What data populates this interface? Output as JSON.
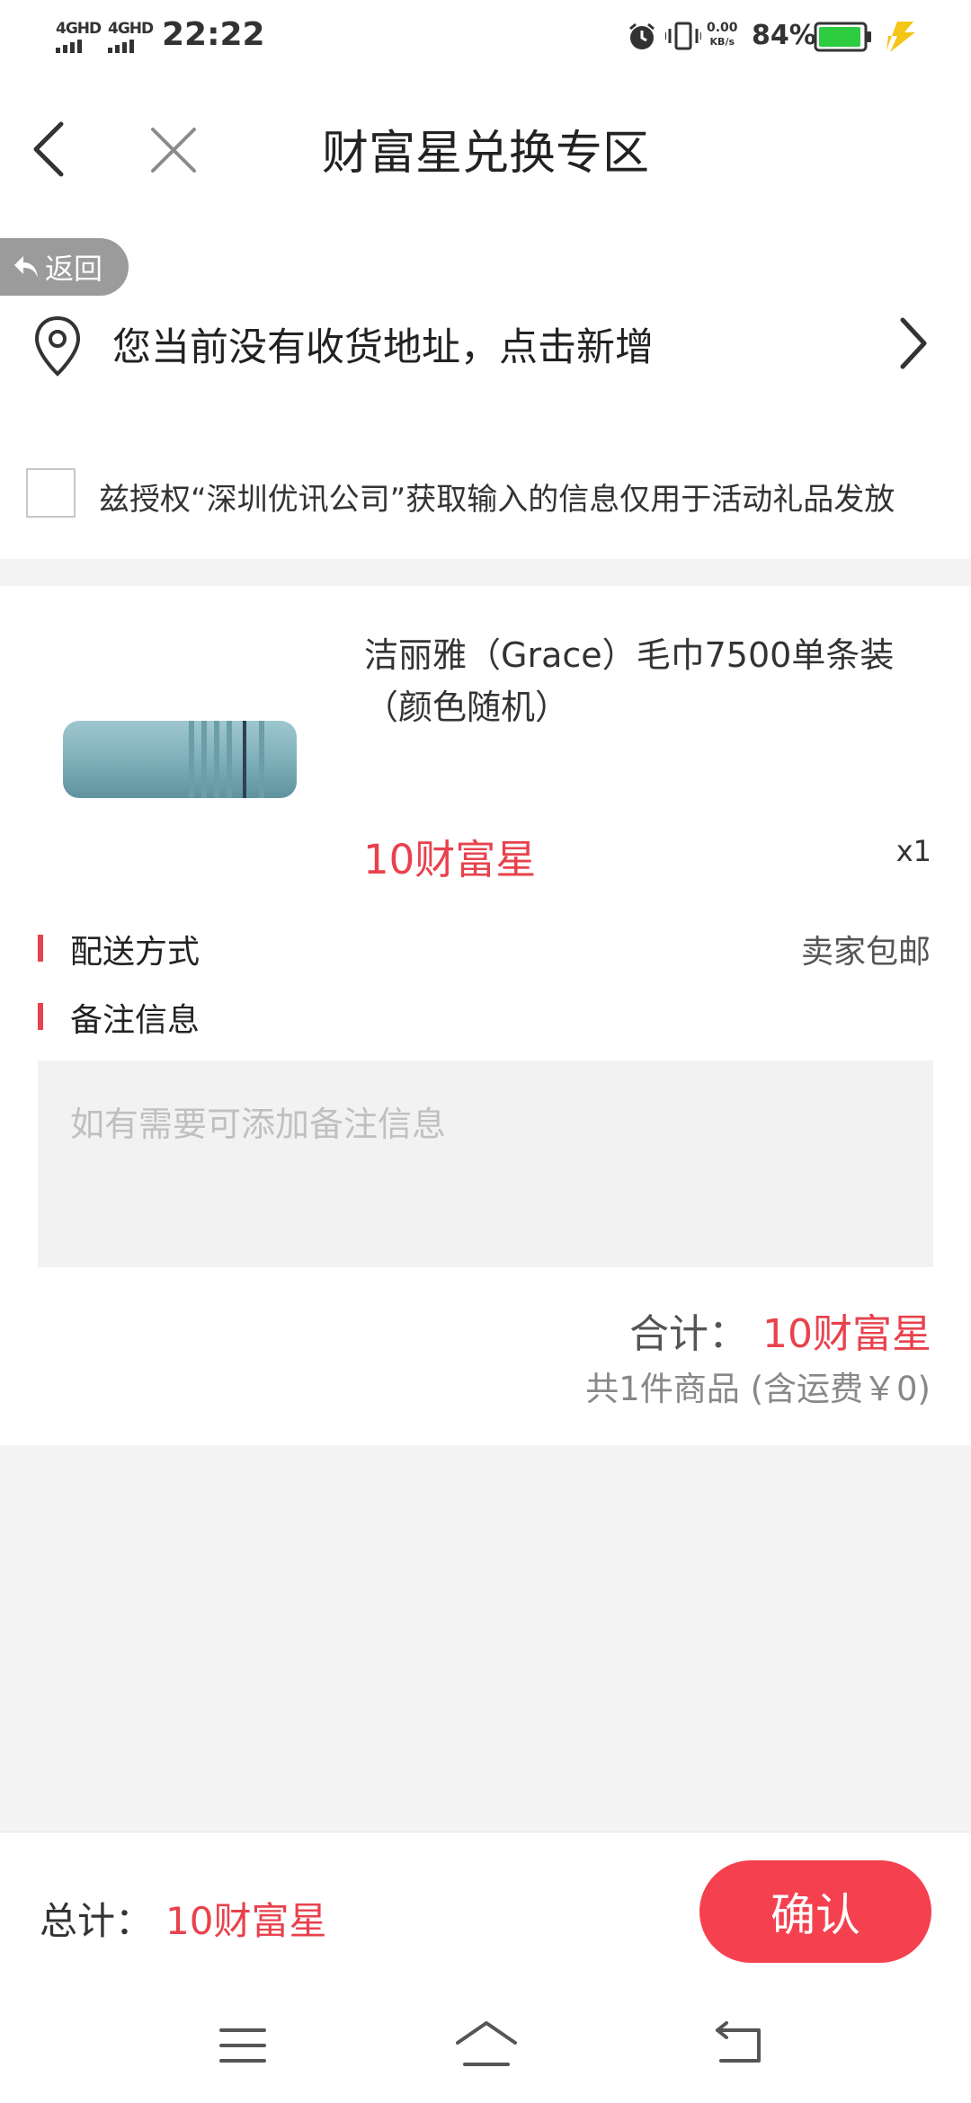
{
  "status_bar": {
    "signal1": "4GHD",
    "signal2": "4GHD",
    "time": "22:22",
    "speed_value": "0.00",
    "speed_unit": "KB/s",
    "battery": "84%"
  },
  "header": {
    "title": "财富星兑换专区"
  },
  "floating": {
    "back_label": "返回"
  },
  "address": {
    "text": "您当前没有收货地址，点击新增"
  },
  "authorization": {
    "text": "兹授权“深圳优讯公司”获取输入的信息仅用于活动礼品发放",
    "checked": false
  },
  "product": {
    "name": "洁丽雅（Grace）毛巾7500单条装（颜色随机）",
    "price": "10财富星",
    "quantity": "x1",
    "image_icon": "towel-image"
  },
  "delivery": {
    "label": "配送方式",
    "value": "卖家包邮"
  },
  "remarks": {
    "label": "备注信息",
    "placeholder": "如有需要可添加备注信息"
  },
  "summary": {
    "label": "合计：",
    "value": "10财富星",
    "detail": "共1件商品 (含运费￥0)"
  },
  "footer": {
    "total_label": "总计：",
    "total_value": "10财富星",
    "confirm_label": "确认"
  },
  "colors": {
    "accent": "#e8424d",
    "button": "#f5404f",
    "battery": "#2ecc40",
    "page_bg": "#f4f4f4"
  }
}
